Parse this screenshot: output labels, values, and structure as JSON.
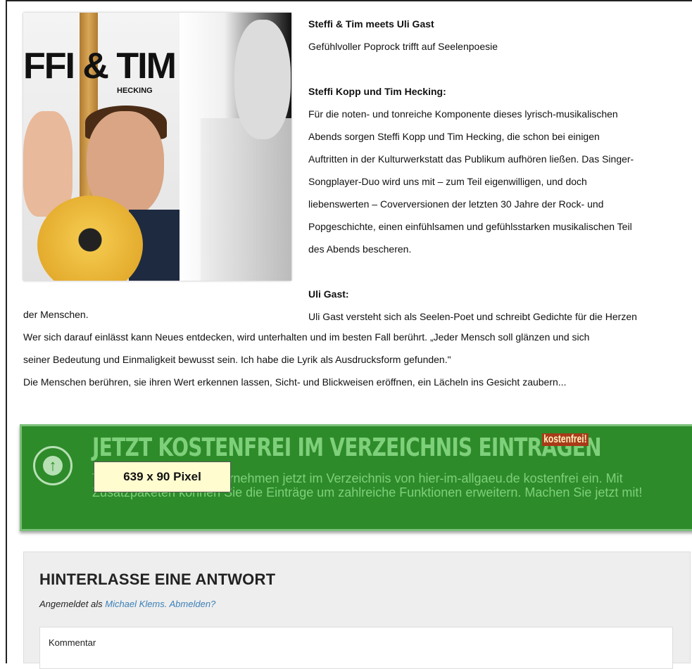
{
  "article": {
    "image": {
      "title": "FFI & TIM",
      "amp": "&",
      "subtitle": "HECKING"
    },
    "heading1": "Steffi & Tim meets Uli Gast",
    "tagline": "Gefühlvoller Poprock trifft auf Seelenpoesie",
    "heading2": "Steffi Kopp und Tim Hecking:",
    "para1_lines": [
      "Für die noten- und tonreiche Komponente dieses lyrisch-musikalischen",
      "Abends sorgen Steffi Kopp und Tim Hecking, die schon bei einigen",
      "Auftritten in der Kulturwerkstatt das Publikum aufhören ließen. Das Singer-",
      "Songplayer-Duo wird uns mit – zum Teil eigenwilligen, und doch",
      "liebenswerten – Coverversionen der letzten 30 Jahre der Rock- und",
      "Popgeschichte, einen einfühlsamen und gefühlsstarken musikalischen Teil",
      "des Abends bescheren."
    ],
    "heading3": "Uli Gast:",
    "para2_first": "Uli Gast versteht sich als Seelen-Poet und schreibt Gedichte für die Herzen",
    "para2_rest_lines": [
      "der Menschen.",
      "Wer sich darauf einlässt kann Neues entdecken, wird unterhalten und im besten Fall berührt. „Jeder Mensch soll glänzen und sich",
      "seiner Bedeutung und Einmaligkeit bewusst sein. Ich habe die Lyrik als Ausdrucksform gefunden.\"",
      "Die Menschen berühren, sie ihren Wert erkennen lassen, Sicht- und Blickweisen eröffnen, ein Lächeln ins Gesicht zaubern..."
    ]
  },
  "banner": {
    "title": "JETZT KOSTENFREI IM VERZEICHNIS EINTRAGEN",
    "badge": "kostenfrei!",
    "body": "Tragen Sie jetzt Ihr Unternehmen jetzt im Verzeichnis von hier-im-allgaeu.de kostenfrei ein. Mit Zusatzpaketen können Sie die Einträge um zahlreiche Funktionen erweitern. Machen Sie jetzt mit!",
    "size_label": "639 x 90 Pixel",
    "icon": "arrow-up-circle-icon",
    "colors": {
      "background": "#2e8b2a",
      "text": "#7ed07a",
      "badge": "#a83a18"
    }
  },
  "reply": {
    "title": "HINTERLASSE EINE ANTWORT",
    "logged_prefix": "Angemeldet als ",
    "user_link": "Michael Klems.",
    "logout_link": "Abmelden?",
    "comment_label": "Kommentar"
  }
}
